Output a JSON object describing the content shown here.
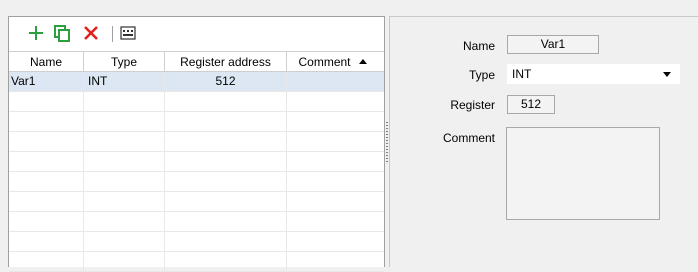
{
  "toolbar": {
    "add_icon": "plus-icon",
    "duplicate_icon": "copy-icon",
    "delete_icon": "delete-x-icon",
    "properties_icon": "grid-view-icon",
    "colors": {
      "add": "#2e9e3f",
      "duplicate": "#2e9e3f",
      "delete": "#e0221d"
    }
  },
  "table": {
    "headers": [
      "Name",
      "Type",
      "Register address",
      "Comment"
    ],
    "sort_icon": "sort-ascending-icon",
    "rows": [
      {
        "name": "Var1",
        "type": "INT",
        "register": "512",
        "comment": ""
      }
    ],
    "selected_row_color": "#dde7f3"
  },
  "properties": {
    "name_label": "Name",
    "name_value": "Var1",
    "type_label": "Type",
    "type_value": "INT",
    "register_label": "Register",
    "register_value": "512",
    "comment_label": "Comment",
    "comment_value": ""
  }
}
